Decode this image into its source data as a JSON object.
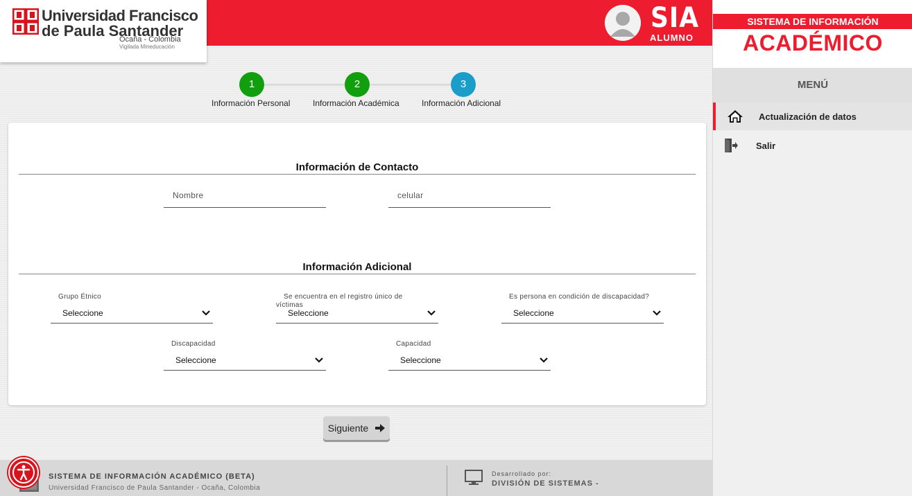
{
  "header": {
    "logo_line1": "Universidad Francisco",
    "logo_line2": "de Paula Santander",
    "logo_line3": "Ocaña - Colombia",
    "logo_line4": "Vigilada Mineducación",
    "app_title": "SIA",
    "app_subtitle": "ALUMNO",
    "icons": {
      "logo": "ufps-logo-icon",
      "avatar": "user-avatar-icon"
    }
  },
  "sidebar": {
    "system_line": "SISTEMA DE INFORMACIÓN",
    "system_name": "ACADÉMICO",
    "menu_title": "MENÚ",
    "items": [
      {
        "label": "Actualización de datos",
        "icon": "home-icon",
        "active": true
      },
      {
        "label": "Salir",
        "icon": "logout-icon",
        "active": false
      }
    ]
  },
  "stepper": {
    "steps": [
      {
        "number": "1",
        "label": "Información Personal",
        "status": "done"
      },
      {
        "number": "2",
        "label": "Información Académica",
        "status": "done"
      },
      {
        "number": "3",
        "label": "Información Adicional",
        "status": "current"
      }
    ],
    "colors": {
      "done": "#119e0f",
      "current": "#1b9dc9"
    }
  },
  "form": {
    "contact": {
      "title": "Información de Contacto",
      "name_placeholder": "Nombre",
      "phone_placeholder": "celular"
    },
    "additional": {
      "title": "Información Adicional",
      "ethnic_group": {
        "label": "Grupo Étnico",
        "value": "Seleccione"
      },
      "victim_registry": {
        "label": "Se encuentra en el registro único de víctimas",
        "value": "Seleccione"
      },
      "disability_condition": {
        "label": "Es persona en condición de discapacidad?",
        "value": "Seleccione"
      },
      "disability": {
        "label": "Discapacidad",
        "value": "Seleccione"
      },
      "capacity": {
        "label": "Capacidad",
        "value": "Seleccione"
      }
    },
    "next_label": "Siguiente"
  },
  "footer": {
    "title": "SISTEMA DE INFORMACIÓN ACADÉMICO (BETA)",
    "subtitle": "Universidad Francisco de Paula Santander - Ocaña, Colombia",
    "developed_by": "Desarrollado por:",
    "division": "DIVISIÓN DE SISTEMAS -"
  },
  "colors": {
    "brand_red": "#ed1c2e",
    "accessibility_red": "#d7131e"
  }
}
